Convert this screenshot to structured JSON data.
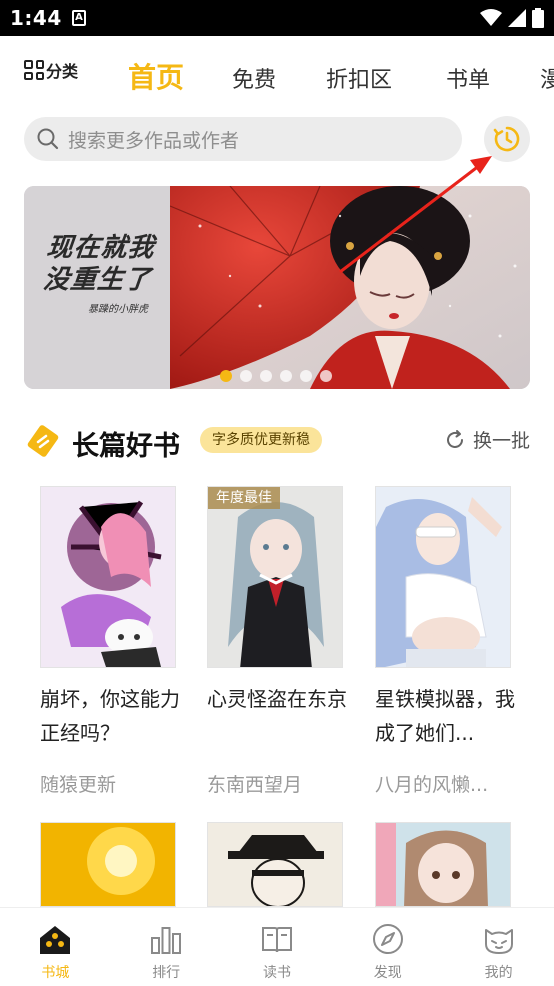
{
  "status_bar": {
    "time": "1:44",
    "notification_icon": "A"
  },
  "top_nav": {
    "category_label": "分类",
    "tabs": [
      {
        "label": "首页",
        "active": true
      },
      {
        "label": "免费",
        "active": false
      },
      {
        "label": "折扣区",
        "active": false
      },
      {
        "label": "书单",
        "active": false
      },
      {
        "label": "漫",
        "active": false
      }
    ]
  },
  "search": {
    "placeholder": "搜索更多作品或作者"
  },
  "banner": {
    "line1": "现在就我",
    "line2": "没重生了",
    "sub": "暴躁的小胖虎",
    "dot_count": 6,
    "active_dot": 0
  },
  "section": {
    "title": "长篇好书",
    "tag": "字多质优更新稳",
    "refresh_label": "换一批"
  },
  "books": [
    {
      "title": "崩坏，你这能力正经吗？",
      "author": "随猿更新",
      "badge": ""
    },
    {
      "title": "心灵怪盗在东京",
      "author": "东南西望月",
      "badge": "年度最佳"
    },
    {
      "title": "星铁模拟器，我成了她们...",
      "author": "八月的风懒...",
      "badge": ""
    }
  ],
  "bottom_nav": [
    {
      "label": "书城",
      "icon": "bookstore-icon",
      "active": true
    },
    {
      "label": "排行",
      "icon": "ranking-icon",
      "active": false
    },
    {
      "label": "读书",
      "icon": "book-open-icon",
      "active": false
    },
    {
      "label": "发现",
      "icon": "compass-icon",
      "active": false
    },
    {
      "label": "我的",
      "icon": "cat-face-icon",
      "active": false
    }
  ],
  "colors": {
    "accent": "#f5b814",
    "arrow": "#e8231b"
  }
}
